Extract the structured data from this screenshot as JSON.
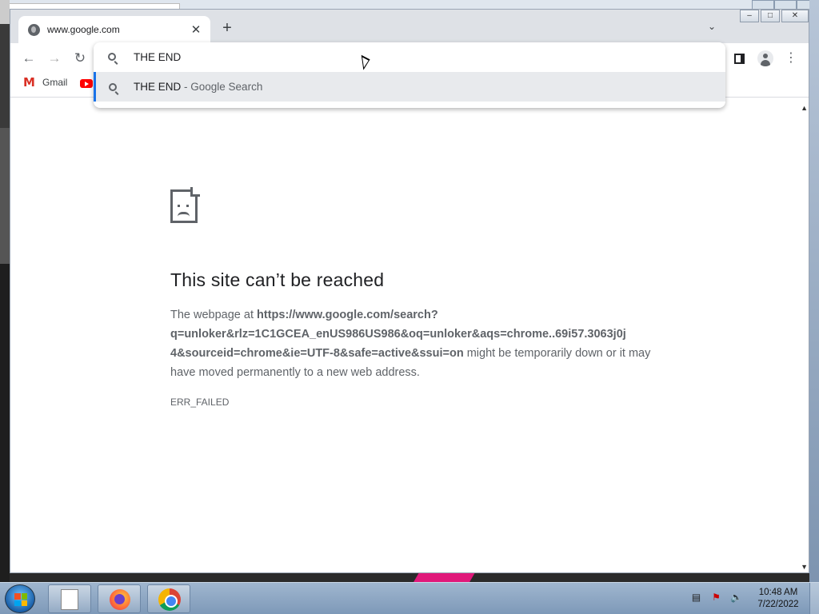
{
  "tab": {
    "title": "www.google.com",
    "close_label": "✕"
  },
  "toolbar": {
    "new_tab_label": "+"
  },
  "omnibox": {
    "input_text": "THE END",
    "suggestion_query": "THE END",
    "suggestion_separator": " - ",
    "suggestion_source": "Google Search"
  },
  "bookmarks": [
    {
      "label": "Gmail",
      "icon": "gmail-icon"
    },
    {
      "label": "",
      "icon": "youtube-icon"
    }
  ],
  "error": {
    "title": "This site can’t be reached",
    "body_prefix": "The webpage at ",
    "url_line1": "https://www.google.com/search?",
    "url_line2": "q=unloker&rlz=1C1GCEA_enUS986US986&oq=unloker&aqs=chrome..69i57.3063j0j",
    "url_line3": "4&sourceid=chrome&ie=UTF-8&safe=active&ssui=on",
    "body_suffix": " might be temporarily down or it may have moved permanently to a new web address.",
    "code": "ERR_FAILED"
  },
  "taskbar": {
    "time": "10:48 AM",
    "date": "7/22/2022",
    "pinned": [
      "file-manager-icon",
      "firefox-icon",
      "chrome-icon"
    ]
  },
  "colors": {
    "accent": "#1a73e8",
    "text_primary": "#202124",
    "text_secondary": "#5f6368"
  }
}
